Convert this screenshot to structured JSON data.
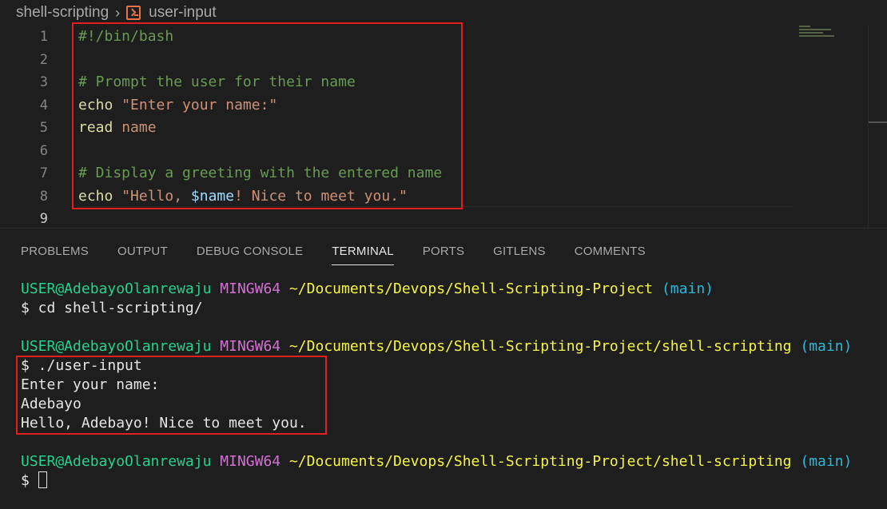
{
  "breadcrumb": {
    "folder": "shell-scripting",
    "file": "user-input"
  },
  "editor": {
    "lines": [
      {
        "num": "1",
        "text": "#!/bin/bash"
      },
      {
        "num": "2",
        "text": ""
      },
      {
        "num": "3",
        "text": "# Prompt the user for their name"
      },
      {
        "num": "4",
        "kw": "echo",
        "str": "\"Enter your name:\""
      },
      {
        "num": "5",
        "kw": "read",
        "arg": "name"
      },
      {
        "num": "6",
        "text": ""
      },
      {
        "num": "7",
        "text": "# Display a greeting with the entered name"
      },
      {
        "num": "8",
        "kw": "echo",
        "str1": "\"Hello, ",
        "var": "$name",
        "str2": "! Nice to meet you.\""
      },
      {
        "num": "9",
        "text": ""
      }
    ]
  },
  "panel": {
    "tabs": [
      "PROBLEMS",
      "OUTPUT",
      "DEBUG CONSOLE",
      "TERMINAL",
      "PORTS",
      "GITLENS",
      "COMMENTS"
    ],
    "active_tab": "TERMINAL"
  },
  "terminal": {
    "user": "USER@AdebayoOlanrewaju",
    "host": "MINGW64",
    "branch": "(main)",
    "path1": "~/Documents/Devops/Shell-Scripting-Project",
    "cmd1": "$ cd shell-scripting/",
    "path2": "~/Documents/Devops/Shell-Scripting-Project/shell-scripting",
    "cmd2": "$ ./user-input",
    "out1": "Enter your name:",
    "out2": "Adebayo",
    "out3": "Hello, Adebayo! Nice to meet you.",
    "prompt": "$ "
  },
  "colors": {
    "highlight_box": "#e02020",
    "accent": "#e7e7e7"
  }
}
